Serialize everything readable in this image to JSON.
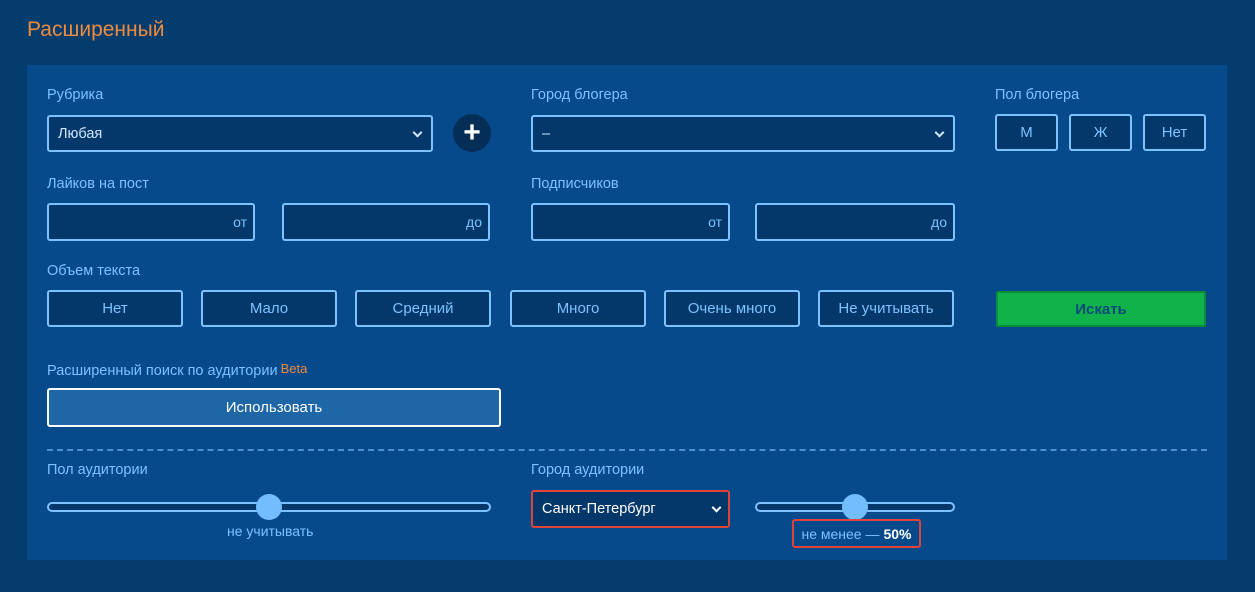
{
  "title": "Расширенный",
  "rubric": {
    "label": "Рубрика",
    "value": "Любая",
    "add": "+"
  },
  "blogger_city": {
    "label": "Город блогера",
    "value": "–"
  },
  "blogger_gender": {
    "label": "Пол блогера",
    "options": [
      "М",
      "Ж",
      "Нет"
    ]
  },
  "likes": {
    "label": "Лайков на пост",
    "from": "от",
    "to": "до"
  },
  "subscribers": {
    "label": "Подписчиков",
    "from": "от",
    "to": "до"
  },
  "text_volume": {
    "label": "Объем текста",
    "options": [
      "Нет",
      "Мало",
      "Средний",
      "Много",
      "Очень много",
      "Не учитывать"
    ]
  },
  "search_button": "Искать",
  "audience_search": {
    "label": "Расширенный поиск по аудитории",
    "beta": "Beta",
    "use_button": "Использовать"
  },
  "audience_gender": {
    "label": "Пол аудитории",
    "caption": "не учитывать",
    "level": 0.5
  },
  "audience_city": {
    "label": "Город аудитории",
    "value": "Санкт-Петербург",
    "caption": "не менее —",
    "percent": "50%",
    "level": 0.5
  },
  "colors": {
    "accent": "#f08a3c",
    "search": "#0fb34a",
    "highlight": "#e0433a"
  }
}
